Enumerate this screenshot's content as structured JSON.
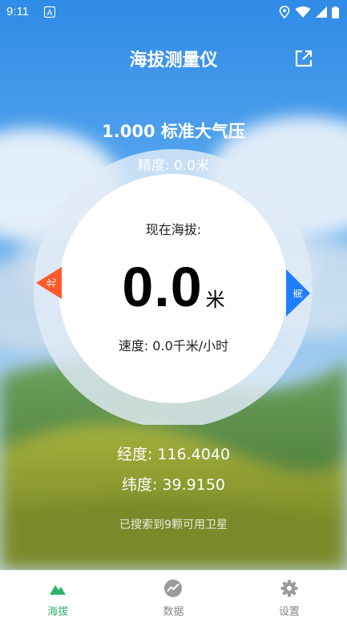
{
  "status_bar": {
    "time": "9:11",
    "a_icon_letter": "A",
    "icons": [
      "location-icon",
      "wifi-icon",
      "signal-icon",
      "battery-icon"
    ]
  },
  "app_bar": {
    "title": "海拔测量仪",
    "share_icon": "open-external-icon"
  },
  "pressure": "1.000 标准大气压",
  "gauge": {
    "accuracy": "精度: 0.0米",
    "current_label": "现在海拔:",
    "altitude_value": "0.0",
    "altitude_unit": "米",
    "speed": "速度: 0.0千米/小时",
    "north_label": "北",
    "south_label": "南",
    "north_color": "#ff5a2b",
    "south_color": "#1f7dff"
  },
  "coordinates": {
    "longitude": "经度: 116.4040",
    "latitude": "纬度: 39.9150"
  },
  "satellites": "已搜索到9颗可用卫星",
  "bottom_nav": {
    "active_color": "#2fb36a",
    "inactive_color": "#888888",
    "items": [
      {
        "label": "海拔",
        "icon": "mountain-icon",
        "active": true
      },
      {
        "label": "数据",
        "icon": "chart-icon",
        "active": false
      },
      {
        "label": "设置",
        "icon": "gear-icon",
        "active": false
      }
    ]
  }
}
